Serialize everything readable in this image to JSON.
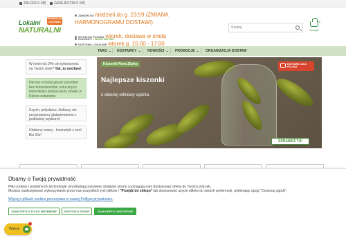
{
  "topbar": {
    "login": "ZALOGUJ SIĘ",
    "register": "ZAREJESTRUJ SIĘ"
  },
  "logo": {
    "line1": "Lokalni",
    "line2": "NATURALNI",
    "suffix": ".pl",
    "badge": "PROMOCJA DOSTAWA"
  },
  "delivery": {
    "order_label": "ZAMÓW DO",
    "order_value": "niedzieli do g. 23:59 (ZMIANA HARMONOGRAMU DOSTAW!)",
    "ship_label": "WYSYŁKA POLSKA",
    "ship_value": "wtorek, dostawa w środę",
    "local_label": "DOSTAWA LOKALNIE",
    "local_value": "wtorek g. 15:00 - 17:00",
    "contact_label": "KONTAKT:",
    "contact_phone": "+48 609 550 022"
  },
  "search": {
    "placeholder": "Szukaj"
  },
  "cart": {
    "count": "0",
    "label": "Koszyk"
  },
  "nav": {
    "items": [
      "TARG",
      "DOSTAWCY",
      "NOWOŚCI",
      "PROMOCJE",
      "ORGANIZACJA DOSTAW"
    ]
  },
  "info_cards": [
    {
      "text": "W mniej niż 24h od wytworzenia na Twoim stole? ",
      "bold": "Tak, to możliwe!"
    },
    {
      "text": "Nie ma w tradycyjnym sposobie: bez konserwantów, sztucznych barwników i polepszaczy smaku w Polsce naturalnie",
      "bold": ""
    },
    {
      "text": "Szynki, polędwice, kiełbasy nie przyprawiamy glutaminianem z podlaskiej wędzarni!",
      "bold": "z podlaskiej wędzarni!"
    },
    {
      "text": "Ulubiony mamy - kosmetyki z serii Bio Glo!",
      "bold": ""
    }
  ],
  "banner": {
    "tag": "Kiszonki Pana Zbyka",
    "headline": "Najlepsze kiszonki",
    "subline": "z własnej odmiany ogórka",
    "delivery_badge": "DOSTAWA CAŁA POLSKA",
    "cta": "SPRAWDŹ TU!"
  },
  "cookie": {
    "title": "Dbamy o Twoją prywatność",
    "text_a": "Pliki cookies i podobne im technologie umożliwiają poprawne działanie strony i pomagają nam dostosować ofertę do Twoich potrzeb.",
    "text_b_prefix": "Możesz zaakceptować wykorzystanie przez nas wszystkich tych plików i ",
    "text_b_bold": "\"Przejdź do sklepu\"",
    "text_b_suffix": " lub dostosować użycie plików do swoich preferencji, wybierając opcję \"Dostosuj zgody\".",
    "policy_link": "Więcej o plikach cookies przeczytasz w naszej Polityce prywatności.",
    "btn_necessary": "ZAAKCEPTUJ TYLKO NIEZBĘDNE",
    "btn_customize": "DOSTOSUJ ZGODY",
    "btn_accept_all": "ZAAKCEPTUJ WSZYSTKIE"
  },
  "chat": {
    "label": "Więcej"
  }
}
